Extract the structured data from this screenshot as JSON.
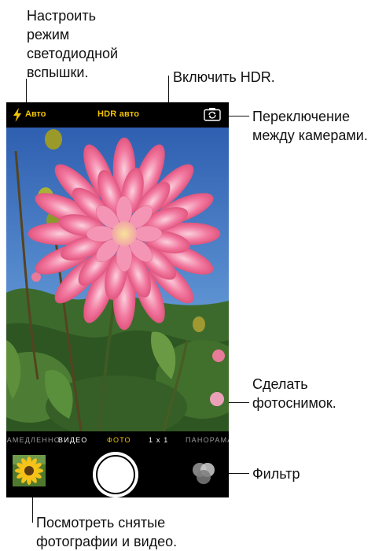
{
  "callouts": {
    "flash_mode": [
      "Настроить",
      "режим",
      "светодиодной",
      "вспышки."
    ],
    "hdr": "Включить HDR.",
    "switch_camera": [
      "Переключение",
      "между камерами."
    ],
    "take_photo": [
      "Сделать",
      "фотоснимок."
    ],
    "filter": "Фильтр",
    "view_photos": [
      "Посмотреть снятые",
      "фотографии и видео."
    ]
  },
  "camera": {
    "flash_label": "Авто",
    "hdr_label": "HDR авто",
    "modes": [
      "ЗАМЕДЛЕННО",
      "ВИДЕО",
      "ФОТО",
      "1 x 1",
      "ПАНОРАМА"
    ],
    "active_mode": "ФОТО",
    "icons": {
      "flash": "lightning-bolt-icon",
      "switch_camera": "camera-rotate-icon",
      "filter": "three-circles-filter-icon"
    },
    "colors": {
      "accent": "#f2c300",
      "bar": "#000000"
    }
  }
}
